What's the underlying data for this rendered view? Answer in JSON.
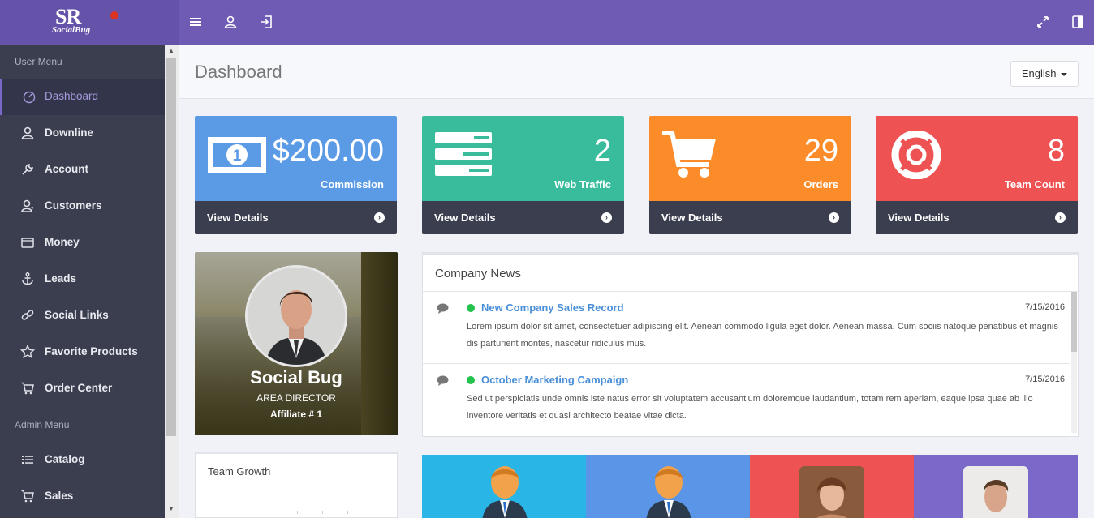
{
  "brand": {
    "logo_main": "SR",
    "logo_sub": "SocialBug"
  },
  "topbar": {
    "icons": [
      "menu-icon",
      "user-icon",
      "sign-out-icon",
      "expand-icon",
      "sidebar-toggle-icon"
    ]
  },
  "sidebar": {
    "user_menu_title": "User Menu",
    "admin_menu_title": "Admin Menu",
    "user_items": [
      {
        "label": "Dashboard",
        "icon": "dashboard-icon",
        "active": true
      },
      {
        "label": "Downline",
        "icon": "user-icon"
      },
      {
        "label": "Account",
        "icon": "wrench-icon"
      },
      {
        "label": "Customers",
        "icon": "customers-icon"
      },
      {
        "label": "Money",
        "icon": "wallet-icon"
      },
      {
        "label": "Leads",
        "icon": "anchor-icon"
      },
      {
        "label": "Social Links",
        "icon": "link-icon"
      },
      {
        "label": "Favorite Products",
        "icon": "star-icon"
      },
      {
        "label": "Order Center",
        "icon": "cart-icon"
      }
    ],
    "admin_items": [
      {
        "label": "Catalog",
        "icon": "list-icon"
      },
      {
        "label": "Sales",
        "icon": "cart-icon"
      }
    ]
  },
  "header": {
    "title": "Dashboard",
    "language": "English"
  },
  "stats": [
    {
      "value": "$200.00",
      "label": "Commission",
      "footer": "View Details",
      "color": "#5b9be6",
      "icon": "money-bill-icon"
    },
    {
      "value": "2",
      "label": "Web Traffic",
      "footer": "View Details",
      "color": "#39bc9c",
      "icon": "server-icon"
    },
    {
      "value": "29",
      "label": "Orders",
      "footer": "View Details",
      "color": "#fc8b2a",
      "icon": "cart-icon"
    },
    {
      "value": "8",
      "label": "Team Count",
      "footer": "View Details",
      "color": "#ee5253",
      "icon": "life-ring-icon"
    }
  ],
  "profile": {
    "name": "Social Bug",
    "role": "AREA DIRECTOR",
    "affiliate": "Affiliate # 1"
  },
  "news": {
    "title": "Company News",
    "items": [
      {
        "title": "New Company Sales Record",
        "date": "7/15/2016",
        "body": "Lorem ipsum dolor sit amet, consectetuer adipiscing elit. Aenean commodo ligula eget dolor. Aenean massa. Cum sociis natoque penatibus et magnis dis parturient montes, nascetur ridiculus mus."
      },
      {
        "title": "October Marketing Campaign",
        "date": "7/15/2016",
        "body": "Sed ut perspiciatis unde omnis iste natus error sit voluptatem accusantium doloremque laudantium, totam rem aperiam, eaque ipsa quae ab illo inventore veritatis et quasi architecto beatae vitae dicta."
      }
    ]
  },
  "growth": {
    "title": "Team Growth"
  },
  "team_tiles": [
    {
      "color": "#29b6e6",
      "kind": "avatar-icon"
    },
    {
      "color": "#5a95e8",
      "kind": "avatar-icon"
    },
    {
      "color": "#ee5253",
      "kind": "photo"
    },
    {
      "color": "#7b68c8",
      "kind": "photo"
    }
  ]
}
